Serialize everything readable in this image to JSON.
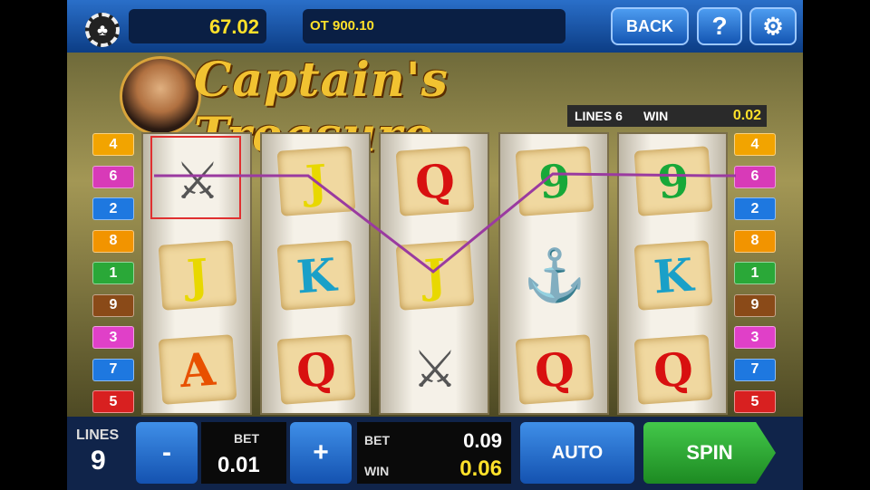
{
  "top": {
    "balance": "67.02",
    "jackpot": "OT 900.10",
    "back_label": "BACK",
    "help_label": "?",
    "settings_icon": "gear-icon"
  },
  "title": {
    "text": "Captain's Treasure",
    "lines_label": "LINES 6",
    "win_label": "WIN",
    "win_value": "0.02"
  },
  "paylines_left": [
    "4",
    "6",
    "2",
    "8",
    "1",
    "9",
    "3",
    "7",
    "5"
  ],
  "paylines_right": [
    "4",
    "6",
    "2",
    "8",
    "1",
    "9",
    "3",
    "7",
    "5"
  ],
  "payline_colors": {
    "4": "#f2a400",
    "6": "#d83ab8",
    "2": "#1e78e0",
    "8": "#f29400",
    "1": "#2aa838",
    "9": "#8a4a18",
    "3": "#e040c8",
    "7": "#1e78e0",
    "5": "#d82020"
  },
  "reels": [
    [
      {
        "type": "swords"
      },
      {
        "type": "card",
        "label": "J",
        "color": "#e8d800"
      },
      {
        "type": "card",
        "label": "A",
        "color": "#e85000"
      }
    ],
    [
      {
        "type": "card",
        "label": "J",
        "color": "#e8d800"
      },
      {
        "type": "card",
        "label": "K",
        "color": "#1aa0c8"
      },
      {
        "type": "card",
        "label": "Q",
        "color": "#d81010"
      }
    ],
    [
      {
        "type": "card",
        "label": "Q",
        "color": "#d81010"
      },
      {
        "type": "card",
        "label": "J",
        "color": "#e8d800"
      },
      {
        "type": "swords"
      }
    ],
    [
      {
        "type": "card",
        "label": "9",
        "color": "#18a838"
      },
      {
        "type": "anchor"
      },
      {
        "type": "card",
        "label": "Q",
        "color": "#d81010"
      }
    ],
    [
      {
        "type": "card",
        "label": "9",
        "color": "#18a838"
      },
      {
        "type": "card",
        "label": "K",
        "color": "#1aa0c8"
      },
      {
        "type": "card",
        "label": "Q",
        "color": "#d81010"
      }
    ]
  ],
  "bottom": {
    "lines_label": "LINES",
    "lines_value": "9",
    "minus_label": "-",
    "plus_label": "+",
    "bet_label": "BET",
    "bet_value": "0.01",
    "total_bet_label": "BET",
    "total_bet_value": "0.09",
    "win_label": "WIN",
    "win_value": "0.06",
    "auto_label": "AUTO",
    "spin_label": "SPIN"
  }
}
